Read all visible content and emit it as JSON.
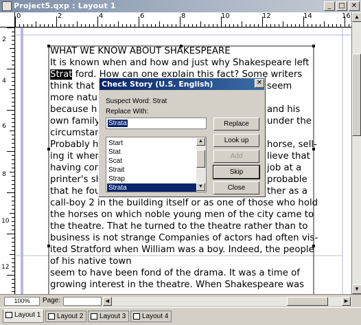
{
  "window": {
    "title": "Project5.qxp : Layout 1"
  },
  "ruler": {
    "h_labels": [
      "0",
      "2",
      "4",
      "6",
      "8",
      "10",
      "12",
      "14",
      "16"
    ],
    "v_labels": [
      "2",
      "4",
      "6",
      "8",
      "10",
      "12"
    ]
  },
  "document": {
    "lines": [
      "WHAT WE KNOW ABOUT SHAKESPEARE",
      "It is known when and how and just why Shakespeare left",
      "ford. How can one explain this fact? Some writers",
      "think that h",
      "more natur",
      "because h",
      "own family",
      "circumstan",
      "Probably h",
      "ing it when",
      "having con",
      "printer's sh",
      "that he fou",
      "call-boy 2 in the building itself or as one of those who hold",
      "the horses on which noble young men of the city came to",
      "the theatre. That he turned to the theatre rather than to",
      "business is not strange Companies of actors had often vis-",
      "ited Stratford when William was a boy. Indeed, the people",
      "of his native town",
      "seem to have been fond of the drama. It was a time of",
      "growing interest in the theatre. When Shakespeare was"
    ],
    "highlighted_word": "Strat",
    "right_fragments": [
      "seem",
      "",
      "and his",
      "under the",
      "",
      "horse, sell-",
      "lieve that",
      "job at a",
      "probable",
      "ther as a"
    ]
  },
  "dialog": {
    "title": "Check Story (U.S. English)",
    "suspect_label": "Suspect Word: Strat",
    "replace_label": "Replace With:",
    "replace_value": "Strata",
    "suggestions": [
      "Start",
      "Stat",
      "Scat",
      "Strait",
      "Strap",
      "Strata"
    ],
    "selected_suggestion": "Strata",
    "buttons": {
      "replace": "Replace",
      "lookup": "Look up",
      "add": "Add",
      "skip": "Skip",
      "close": "Close"
    }
  },
  "statusbar": {
    "zoom": "100%",
    "pages_label": "Page:"
  },
  "tabs": [
    "Layout 1",
    "Layout 2",
    "Layout 3",
    "Layout 4"
  ]
}
